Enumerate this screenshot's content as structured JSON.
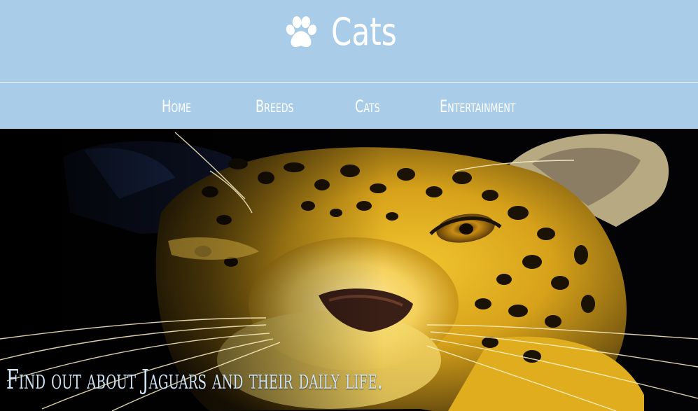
{
  "brand": {
    "title": "Cats",
    "logo_icon": "paw-icon"
  },
  "nav": {
    "items": [
      {
        "label": "Home"
      },
      {
        "label": "Breeds"
      },
      {
        "label": "Cats"
      },
      {
        "label": "Entertainment"
      }
    ]
  },
  "hero": {
    "image_subject": "jaguar",
    "caption": "Find out about Jaguars and their daily life."
  },
  "colors": {
    "header_bg": "#a9cde8",
    "text": "#ffffff",
    "caption": "#cfe4f6"
  }
}
